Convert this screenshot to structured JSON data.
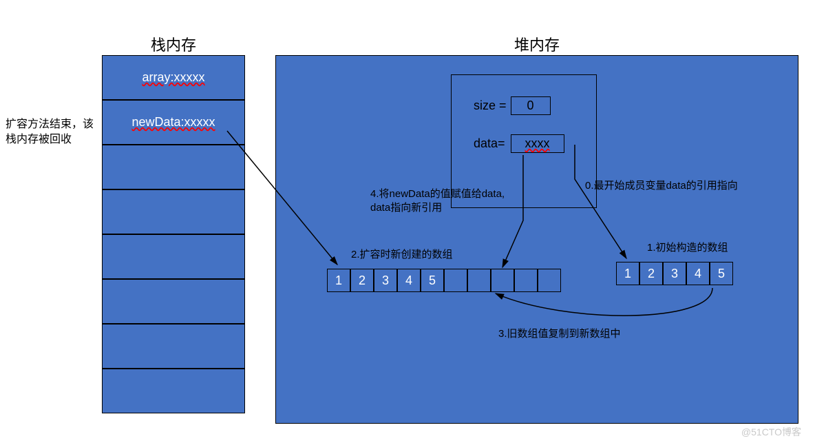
{
  "titles": {
    "stack": "栈内存",
    "heap": "堆内存"
  },
  "stack": {
    "row0": "array:xxxxx",
    "row1": "newData:xxxxx",
    "sideNote": "扩容方法结束，该栈内存被回收"
  },
  "object": {
    "sizeLabel": "size =",
    "sizeValue": "0",
    "dataLabel": "data=",
    "dataValue": "xxxx"
  },
  "arrays": {
    "newArr": [
      "1",
      "2",
      "3",
      "4",
      "5",
      "",
      "",
      "",
      "",
      ""
    ],
    "oldArr": [
      "1",
      "2",
      "3",
      "4",
      "5"
    ]
  },
  "labels": {
    "l0": "0.最开始成员变量data的引用指向",
    "l1": "1.初始构造的数组",
    "l2": "2.扩容时新创建的数组",
    "l3": "3.旧数组值复制到新数组中",
    "l4a": "4.将newData的值赋值给data,",
    "l4b": "data指向新引用"
  },
  "watermark": "@51CTO博客"
}
